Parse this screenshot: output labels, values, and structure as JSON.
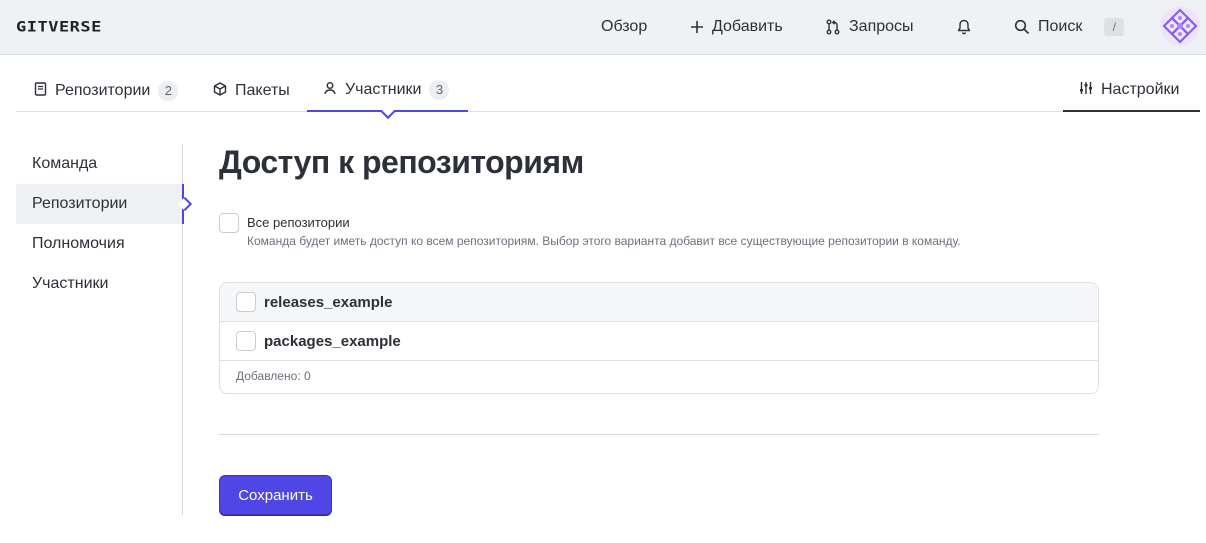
{
  "header": {
    "logo": "GITVERSE",
    "nav": {
      "overview": "Обзор",
      "add": "Добавить",
      "requests": "Запросы",
      "search": "Поиск",
      "search_shortcut": "/"
    },
    "icons": [
      "plus-icon",
      "pull-request-icon",
      "bell-icon",
      "search-icon"
    ]
  },
  "tabs": {
    "repositories": {
      "label": "Репозитории",
      "count": "2"
    },
    "packages": {
      "label": "Пакеты"
    },
    "members": {
      "label": "Участники",
      "count": "3"
    },
    "settings": {
      "label": "Настройки"
    },
    "active": "members"
  },
  "side_menu": {
    "items": [
      "Команда",
      "Репозитории",
      "Полномочия",
      "Участники"
    ],
    "active": "Репозитории"
  },
  "main": {
    "title": "Доступ к репозиториям",
    "all_repos": {
      "label": "Все репозитории",
      "hint": "Команда будет иметь доступ ко всем репозиториям. Выбор этого варианта добавит все существующие репозитории в команду.",
      "checked": false
    },
    "repos": [
      {
        "name": "releases_example",
        "checked": false
      },
      {
        "name": "packages_example",
        "checked": false
      }
    ],
    "added_text": "Добавлено: 0",
    "save_label": "Сохранить"
  },
  "colors": {
    "accent": "#4f46e5",
    "header_bg": "#eff2f5",
    "text": "#2c3039",
    "muted": "#6b717c"
  }
}
